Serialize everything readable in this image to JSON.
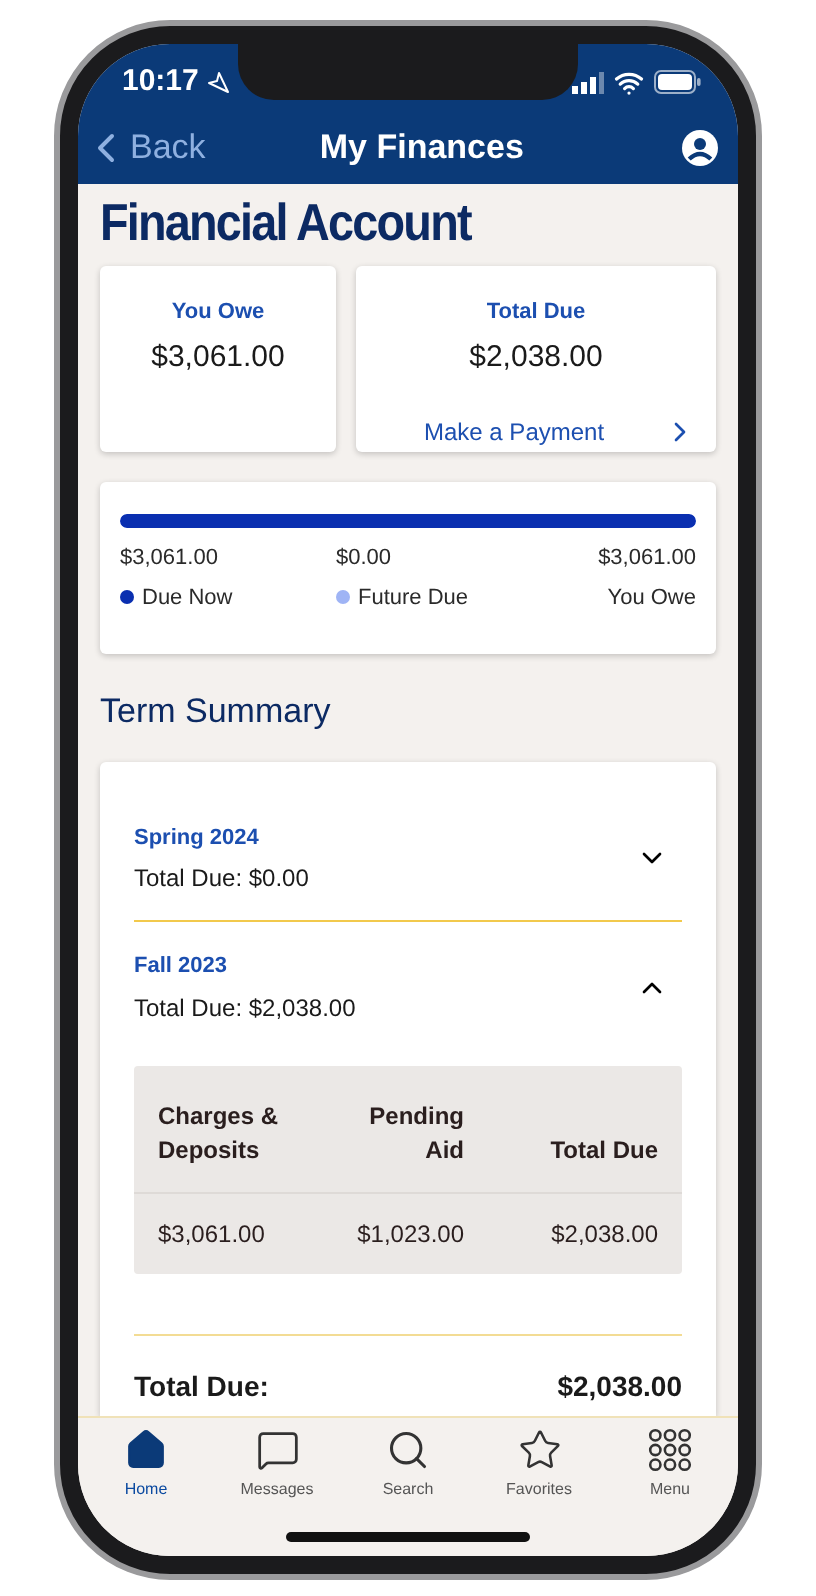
{
  "status_bar": {
    "time": "10:17"
  },
  "nav": {
    "back": "Back",
    "title": "My Finances"
  },
  "page_title": "Financial Account",
  "summary_cards": [
    {
      "label": "You Owe",
      "amount": "$3,061.00"
    },
    {
      "label": "Total Due",
      "amount": "$2,038.00",
      "link": "Make a Payment"
    }
  ],
  "balance": {
    "level": 1,
    "legend": [
      {
        "amount": "$3,061.00",
        "label": "Due Now",
        "color": "#0a2fb0"
      },
      {
        "amount": "$0.00",
        "label": "Future Due",
        "color": "#9fb4f5"
      },
      {
        "amount": "$3,061.00",
        "label": "You Owe"
      }
    ]
  },
  "term_summary": {
    "heading": "Term Summary",
    "terms": [
      {
        "term": "Spring 2024",
        "total": "Total Due: $0.00",
        "expanded": false
      },
      {
        "term": "Fall 2023",
        "total": "Total Due: $2,038.00",
        "expanded": true,
        "table": {
          "columns": [
            "Charges & Deposits",
            "Pending Aid",
            "Total Due"
          ],
          "row": [
            "$3,061.00",
            "$1,023.00",
            "$2,038.00"
          ]
        }
      }
    ],
    "total_label": "Total Due:",
    "total_value": "$2,038.00"
  },
  "tab_bar": [
    {
      "label": "Home",
      "kind": "home",
      "selected": true
    },
    {
      "label": "Messages",
      "kind": "messages",
      "selected": false
    },
    {
      "label": "Search",
      "kind": "search",
      "selected": false
    },
    {
      "label": "Favorites",
      "kind": "favorites",
      "selected": false
    },
    {
      "label": "Menu",
      "kind": "menu",
      "selected": false
    }
  ]
}
